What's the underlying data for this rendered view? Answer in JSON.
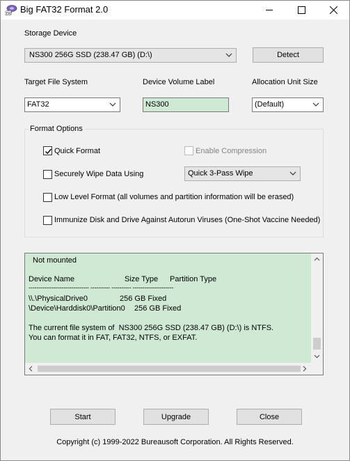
{
  "window": {
    "title": "Big FAT32 Format 2.0",
    "app_icon": "fat-disk-icon"
  },
  "storage": {
    "label": "Storage Device",
    "device_value": "NS300 256G SSD (238.47 GB) (D:\\)",
    "detect_label": "Detect"
  },
  "filesystem": {
    "label": "Target File System",
    "value": "FAT32"
  },
  "volume": {
    "label": "Device Volume Label",
    "value": "NS300"
  },
  "allocation": {
    "label": "Allocation Unit Size",
    "value": "(Default)"
  },
  "format_options": {
    "title": "Format Options",
    "quick_format": {
      "label": "Quick Format",
      "checked": true
    },
    "enable_compression": {
      "label": "Enable Compression",
      "checked": false,
      "enabled": false
    },
    "secure_wipe": {
      "label": "Securely Wipe Data Using",
      "checked": false
    },
    "wipe_method": "Quick 3-Pass Wipe",
    "low_level": {
      "label": "Low Level Format (all volumes and partition information will be erased)",
      "checked": false
    },
    "immunize": {
      "label": "Immunize Disk and Drive Against Autorun Viruses (One-Shot Vaccine Needed)",
      "checked": false
    }
  },
  "log": {
    "status": "Not mounted",
    "header_name": "Device Name",
    "header_size": "Size Type",
    "header_partition": "Partition Type",
    "separator": "------------------------------- ---------- ---------- ---------------------",
    "row1_name": "\\\\.\\PhysicalDrive0",
    "row1_size": "256 GB Fixed",
    "row2_name": "\\Device\\Harddisk0\\Partition0",
    "row2_size": "256 GB Fixed",
    "msg1": "The current file system of  NS300 256G SSD (238.47 GB) (D:\\) is NTFS.",
    "msg2": "You can format it in FAT, FAT32, NTFS, or EXFAT."
  },
  "buttons": {
    "start": "Start",
    "upgrade": "Upgrade",
    "close": "Close"
  },
  "copyright": "Copyright (c) 1999-2022 Bureausoft Corporation. All Rights Reserved."
}
